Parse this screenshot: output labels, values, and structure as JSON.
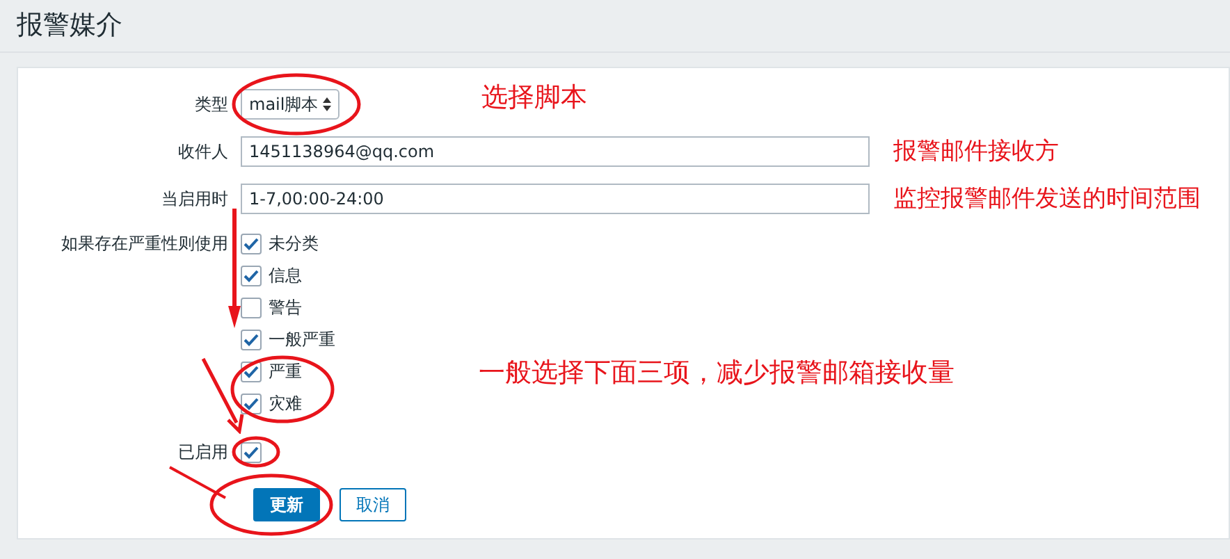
{
  "title": "报警媒介",
  "form": {
    "type": {
      "label": "类型",
      "value": "mail脚本"
    },
    "recipient": {
      "label": "收件人",
      "value": "1451138964@qq.com"
    },
    "when_active": {
      "label": "当启用时",
      "value": "1-7,00:00-24:00"
    },
    "severity": {
      "label": "如果存在严重性则使用",
      "options": [
        {
          "label": "未分类",
          "checked": true
        },
        {
          "label": "信息",
          "checked": true
        },
        {
          "label": "警告",
          "checked": false
        },
        {
          "label": "一般严重",
          "checked": true
        },
        {
          "label": "严重",
          "checked": true
        },
        {
          "label": "灾难",
          "checked": true
        }
      ]
    },
    "enabled": {
      "label": "已启用",
      "checked": true
    },
    "buttons": [
      {
        "label": "更新",
        "kind": "primary"
      },
      {
        "label": "取消",
        "kind": "secondary"
      }
    ]
  },
  "annotations": [
    "选择脚本",
    "报警邮件接收方",
    "监控报警邮件发送的时间范围",
    "一般选择下面三项，减少报警邮箱接收量"
  ]
}
